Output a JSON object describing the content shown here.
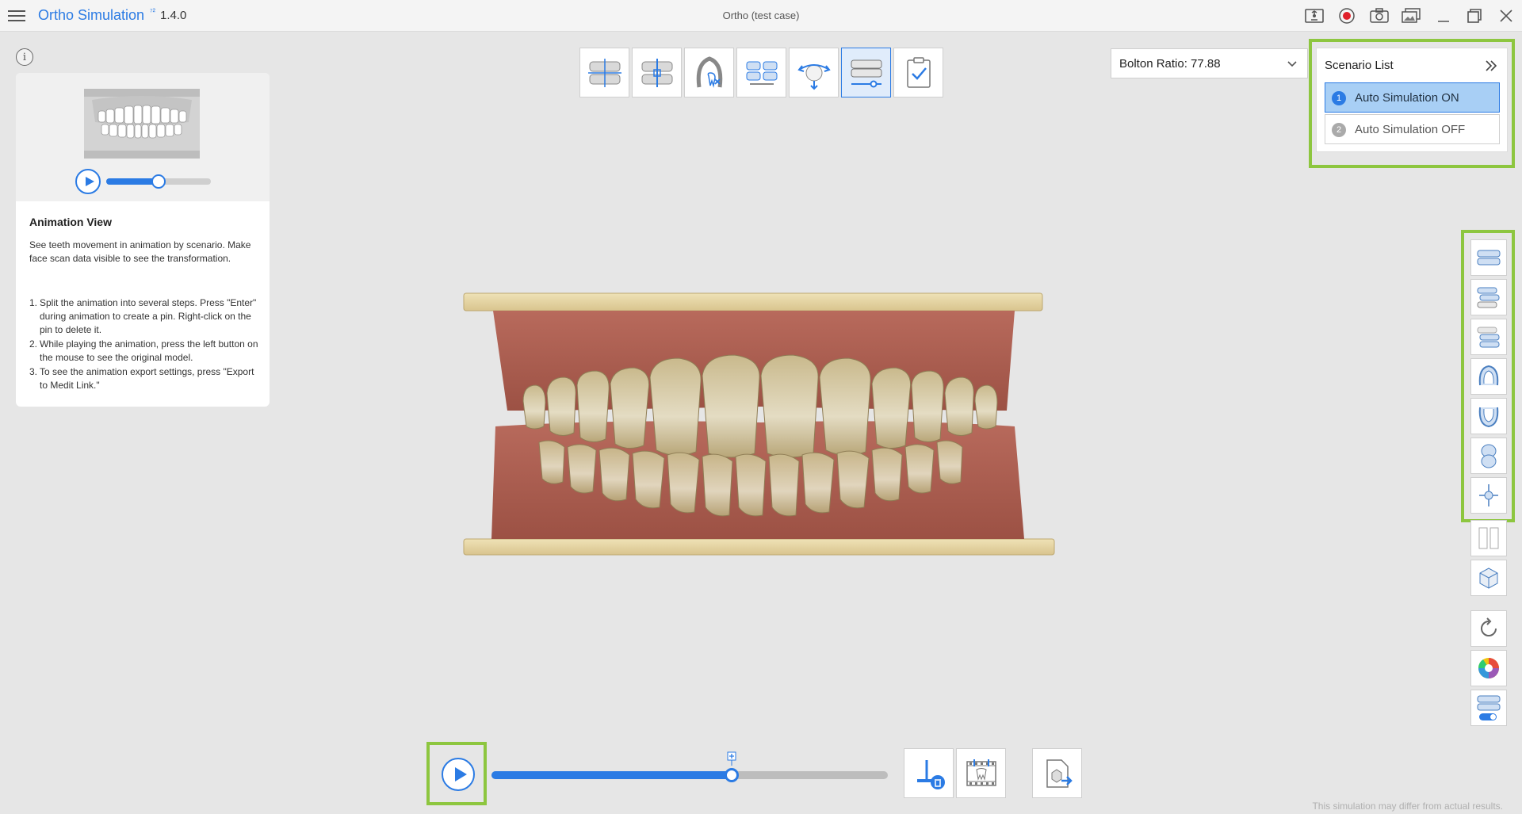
{
  "titlebar": {
    "app_name": "Ortho Simulation",
    "app_badge": "⁷²",
    "version": "1.4.0",
    "document_title": "Ortho (test case)"
  },
  "help": {
    "title": "Animation View",
    "description": "See teeth movement in animation by scenario. Make face scan data visible to see the transformation.",
    "preview_progress": 0.5,
    "steps": [
      {
        "num": "1.",
        "text": "Split the animation into several steps. Press \"Enter\" during animation to create a pin. Right-click on the pin to delete it."
      },
      {
        "num": "2.",
        "text": "While playing the animation, press the left button on the mouse to see the original model."
      },
      {
        "num": "3.",
        "text": "To see the animation export settings, press \"Export to Medit Link.\""
      }
    ]
  },
  "bolton": {
    "label": "Bolton Ratio: 77.88"
  },
  "scenario": {
    "title": "Scenario List",
    "items": [
      {
        "num": "1",
        "label": "Auto Simulation ON",
        "selected": true
      },
      {
        "num": "2",
        "label": "Auto Simulation OFF",
        "selected": false
      }
    ]
  },
  "timeline": {
    "progress": 0.605
  },
  "footer": {
    "disclaimer": "This simulation may differ from actual results."
  },
  "colors": {
    "accent": "#2b7be4",
    "highlight": "#8dc63f",
    "record": "#e0202a"
  }
}
